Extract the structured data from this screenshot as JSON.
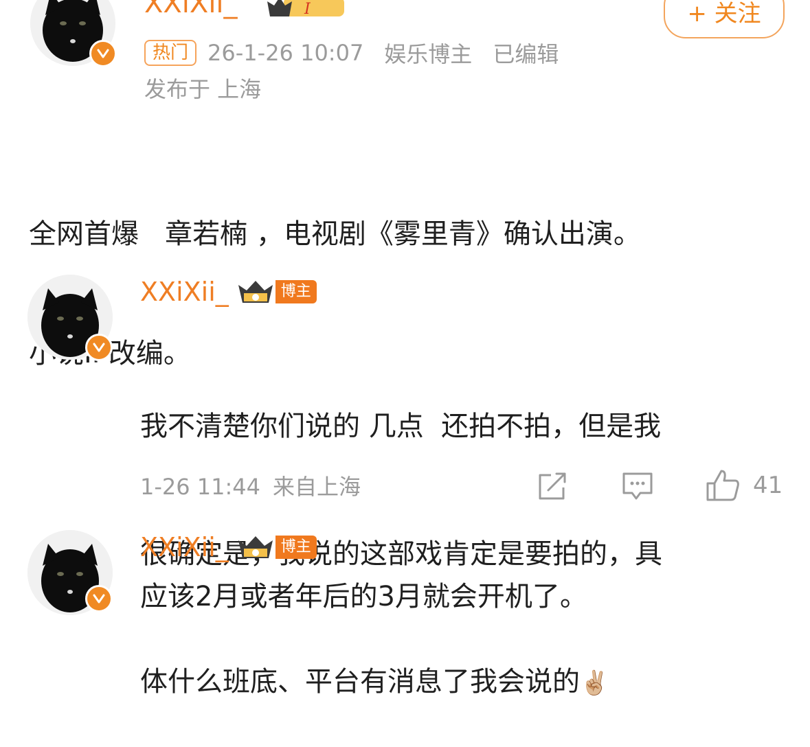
{
  "post": {
    "username": "XXiXii_",
    "hot_tag": "热门",
    "time": "26-1-26 10:07",
    "category": "娱乐博主",
    "edited": "已编辑",
    "location": "发布于 上海",
    "follow_label": "+ 关注",
    "content_line1": "全网首爆   章若楠 ，电视剧《雾里青》确认出演。",
    "content_line2": "小说IP改编。"
  },
  "comments": [
    {
      "username": "XXiXii_",
      "badge": "博主",
      "text_line1": "我不清楚你们说的 几点  还拍不拍，但是我",
      "text_line2": "很确定是，我说的这部戏肯定是要拍的，具",
      "text_line3": "体什么班底、平台有消息了我会说的",
      "emoji": "✌🏼",
      "time": "1-26 11:44",
      "source": "来自上海",
      "likes": "41"
    },
    {
      "username": "XXiXii_",
      "badge": "博主",
      "text_line1": "应该2月或者年后的3月就会开机了。"
    }
  ],
  "colors": {
    "accent": "#ef7e24",
    "meta_gray": "#9b9b9b",
    "verified": "#f08a24"
  }
}
